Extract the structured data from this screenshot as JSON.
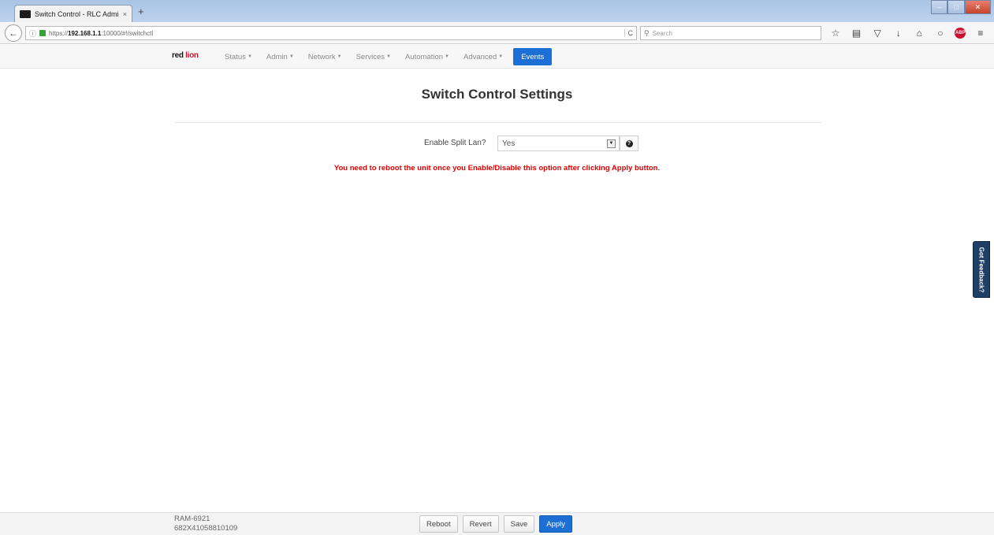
{
  "browser": {
    "tab_title": "Switch Control - RLC Admi...",
    "tab_close": "×",
    "new_tab": "+",
    "url": "https://192.168.1.1:10000/#!/switchctl",
    "url_prefix": "https://",
    "url_host": "192.168.1.1",
    "url_rest": ":10000/#!/switchctl",
    "search_placeholder": "Search",
    "toolbar_icons": [
      "star-icon",
      "reader-icon",
      "pocket-icon",
      "download-icon",
      "home-icon",
      "chat-icon",
      "adblock-icon",
      "menu-icon"
    ]
  },
  "app": {
    "brand_red": "red",
    "brand_lion": "lion",
    "menu": [
      {
        "label": "Status"
      },
      {
        "label": "Admin"
      },
      {
        "label": "Network"
      },
      {
        "label": "Services"
      },
      {
        "label": "Automation"
      },
      {
        "label": "Advanced"
      }
    ],
    "events_label": "Events"
  },
  "main": {
    "title": "Switch Control Settings",
    "split_lan_label": "Enable Split Lan?",
    "split_lan_value": "Yes",
    "warning": "You need to reboot the unit once you Enable/Disable this option after clicking Apply button."
  },
  "feedback_label": "Got Feedback?",
  "footer": {
    "model": "RAM-6921",
    "serial": "682X41058810109",
    "reboot_label": "Reboot",
    "revert_label": "Revert",
    "save_label": "Save",
    "apply_label": "Apply"
  },
  "colors": {
    "accent": "#1c6fd4",
    "warning": "#e00000",
    "brand_red": "#c8102e",
    "feedback_bg": "#1f3f66"
  }
}
